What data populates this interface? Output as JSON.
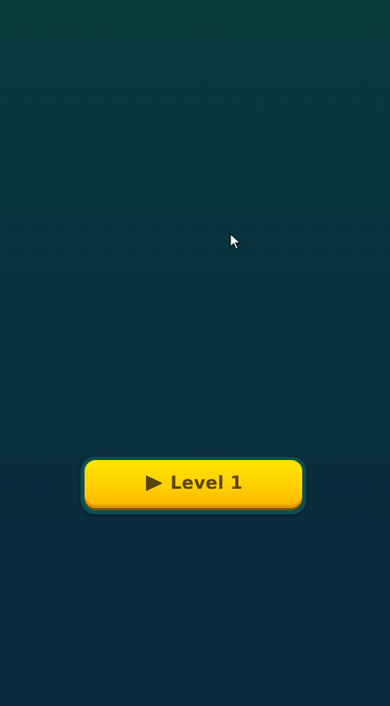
{
  "screen": {
    "background_top": "#083a3b",
    "background_bottom": "#0a2a40"
  },
  "play_button": {
    "label": "Level 1",
    "icon": "play-icon",
    "color": "#ffd000",
    "text_color": "#5a4410"
  },
  "cursor": {
    "icon": "cursor-arrow-icon"
  }
}
